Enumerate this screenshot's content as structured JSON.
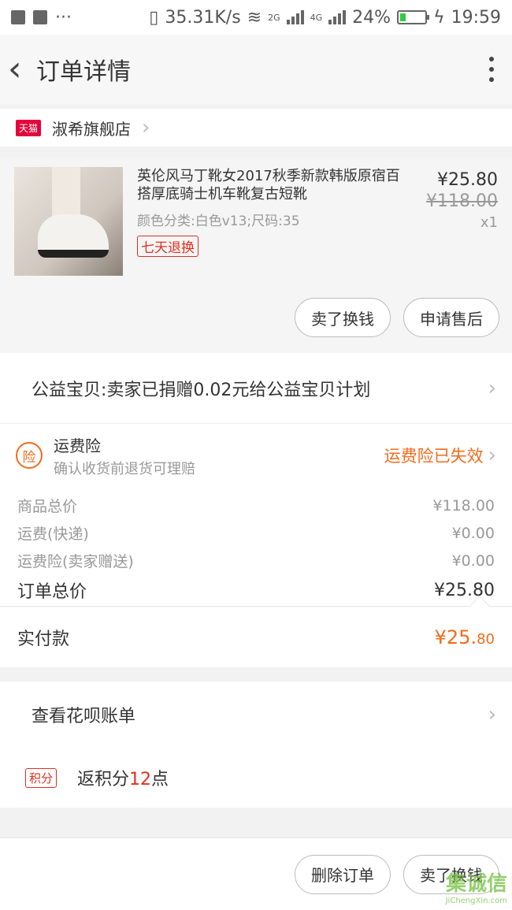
{
  "status_bar": {
    "speed": "35.31K/s",
    "network_a": "2G",
    "network_b": "4G",
    "battery": "24%",
    "time": "19:59"
  },
  "nav": {
    "title": "订单详情"
  },
  "store": {
    "badge": "天猫",
    "name": "淑希旗舰店"
  },
  "product": {
    "title": "英伦风马丁靴女2017秋季新款韩版原宿百搭厚底骑士机车靴复古短靴",
    "sku": "颜色分类:白色v13;尺码:35",
    "tag": "七天退换",
    "price": "¥25.80",
    "original_price": "¥118.00",
    "quantity": "x1",
    "sell_button": "卖了换钱",
    "aftersale_button": "申请售后"
  },
  "charity": {
    "text": "公益宝贝:卖家已捐赠0.02元给公益宝贝计划"
  },
  "insurance": {
    "icon_text": "险",
    "title": "运费险",
    "subtitle": "确认收货前退货可理赔",
    "status": "运费险已失效"
  },
  "fees": {
    "goods_total_label": "商品总价",
    "goods_total": "¥118.00",
    "shipping_label": "运费(快递)",
    "shipping": "¥0.00",
    "insurance_label": "运费险(卖家赠送)",
    "insurance": "¥0.00",
    "order_total_label": "订单总价",
    "order_total": "¥25.80"
  },
  "paid": {
    "label": "实付款",
    "amount_main": "¥25.",
    "amount_cents": "80"
  },
  "huabei": {
    "text": "查看花呗账单"
  },
  "points": {
    "tag": "积分",
    "prefix": "返积分",
    "number": "12",
    "suffix": "点"
  },
  "bottom": {
    "delete_button": "删除订单",
    "sell_button": "卖了换钱"
  },
  "watermark": {
    "main": "集诚信",
    "sub": "JiChengXin.com"
  }
}
